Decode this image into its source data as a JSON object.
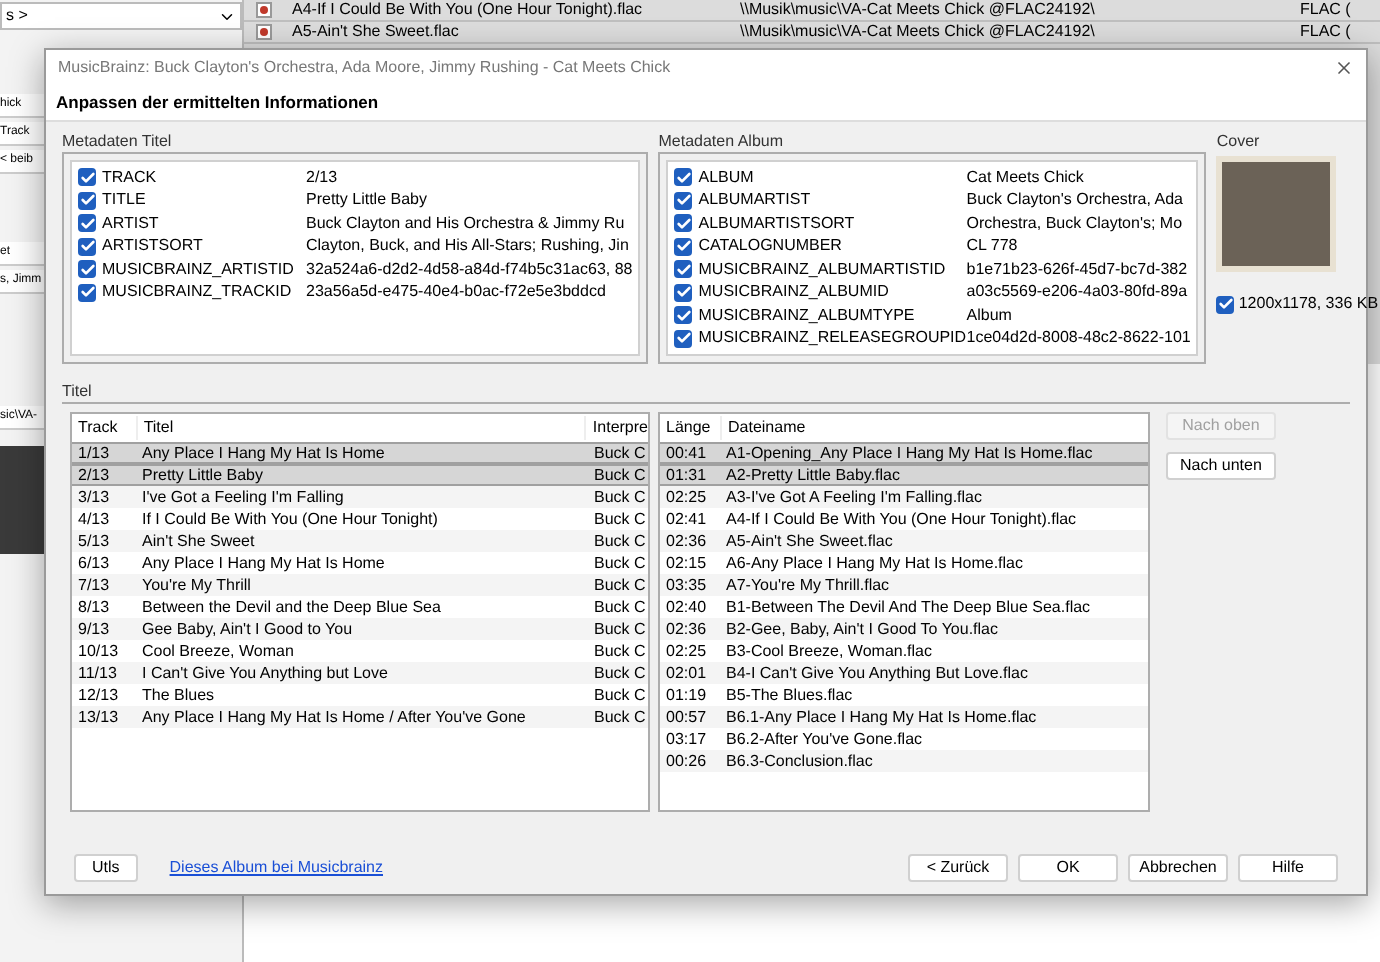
{
  "background": {
    "left_panel": {
      "dropdown_value": "s >",
      "fragments": [
        "hick",
        "Track",
        "< beib",
        "et",
        "s, Jimm",
        "sic\\VA-"
      ]
    },
    "file_rows": [
      {
        "name": "A4-If I Could Be With You (One Hour Tonight).flac",
        "path": "\\\\Musik\\music\\VA-Cat Meets Chick @FLAC24192\\",
        "format": "FLAC ("
      },
      {
        "name": "A5-Ain't She Sweet.flac",
        "path": "\\\\Musik\\music\\VA-Cat Meets Chick @FLAC24192\\",
        "format": "FLAC ("
      }
    ]
  },
  "dialog": {
    "title": "MusicBrainz: Buck Clayton's Orchestra, Ada Moore, Jimmy Rushing - Cat Meets Chick",
    "heading": "Anpassen der ermittelten Informationen",
    "track_metadata": {
      "label": "Metadaten Titel",
      "rows": [
        {
          "key": "TRACK",
          "value": "2/13",
          "checked": true
        },
        {
          "key": "TITLE",
          "value": "Pretty Little Baby",
          "checked": true
        },
        {
          "key": "ARTIST",
          "value": "Buck Clayton and His Orchestra & Jimmy Ru",
          "checked": true
        },
        {
          "key": "ARTISTSORT",
          "value": "Clayton, Buck, and His All-Stars; Rushing, Jin",
          "checked": true
        },
        {
          "key": "MUSICBRAINZ_ARTISTID",
          "value": "32a524a6-d2d2-4d58-a84d-f74b5c31ac63, 88",
          "checked": true
        },
        {
          "key": "MUSICBRAINZ_TRACKID",
          "value": "23a56a5d-e475-40e4-b0ac-f72e5e3bddcd",
          "checked": true
        }
      ]
    },
    "album_metadata": {
      "label": "Metadaten Album",
      "rows": [
        {
          "key": "ALBUM",
          "value": "Cat Meets Chick",
          "checked": true
        },
        {
          "key": "ALBUMARTIST",
          "value": "Buck Clayton's Orchestra, Ada",
          "checked": true
        },
        {
          "key": "ALBUMARTISTSORT",
          "value": "Orchestra, Buck Clayton's; Mo",
          "checked": true
        },
        {
          "key": "CATALOGNUMBER",
          "value": "CL 778",
          "checked": true
        },
        {
          "key": "MUSICBRAINZ_ALBUMARTISTID",
          "value": "b1e71b23-626f-45d7-bc7d-382",
          "checked": true
        },
        {
          "key": "MUSICBRAINZ_ALBUMID",
          "value": "a03c5569-e206-4a03-80fd-89a",
          "checked": true
        },
        {
          "key": "MUSICBRAINZ_ALBUMTYPE",
          "value": "Album",
          "checked": true
        },
        {
          "key": "MUSICBRAINZ_RELEASEGROUPID",
          "value": "1ce04d2d-8008-48c2-8622-101",
          "checked": true
        }
      ]
    },
    "cover": {
      "label": "Cover",
      "info": "1200x1178, 336 KB",
      "checked": true
    },
    "titles": {
      "label": "Titel",
      "track_columns": [
        "Track",
        "Titel",
        "Interpre"
      ],
      "tracks": [
        {
          "track": "1/13",
          "title": "Any Place I Hang My Hat Is Home",
          "artist": "Buck C",
          "selected": true
        },
        {
          "track": "2/13",
          "title": "Pretty Little Baby",
          "artist": "Buck C",
          "selected": true
        },
        {
          "track": "3/13",
          "title": "I've Got a Feeling I'm Falling",
          "artist": "Buck C",
          "selected": false
        },
        {
          "track": "4/13",
          "title": "If I Could Be With You (One Hour Tonight)",
          "artist": "Buck C",
          "selected": false
        },
        {
          "track": "5/13",
          "title": "Ain't She Sweet",
          "artist": "Buck C",
          "selected": false
        },
        {
          "track": "6/13",
          "title": "Any Place I Hang My Hat Is Home",
          "artist": "Buck C",
          "selected": false
        },
        {
          "track": "7/13",
          "title": "You're My Thrill",
          "artist": "Buck C",
          "selected": false
        },
        {
          "track": "8/13",
          "title": "Between the Devil and the Deep Blue Sea",
          "artist": "Buck C",
          "selected": false
        },
        {
          "track": "9/13",
          "title": "Gee Baby, Ain't I Good to You",
          "artist": "Buck C",
          "selected": false
        },
        {
          "track": "10/13",
          "title": "Cool Breeze, Woman",
          "artist": "Buck C",
          "selected": false
        },
        {
          "track": "11/13",
          "title": "I Can't Give You Anything but Love",
          "artist": "Buck C",
          "selected": false
        },
        {
          "track": "12/13",
          "title": "The Blues",
          "artist": "Buck C",
          "selected": false
        },
        {
          "track": "13/13",
          "title": "Any Place I Hang My Hat Is Home / After You've Gone",
          "artist": "Buck C",
          "selected": false
        }
      ],
      "file_columns": [
        "Länge",
        "Dateiname"
      ],
      "files": [
        {
          "length": "00:41",
          "name": "A1-Opening_Any Place I Hang My Hat Is Home.flac",
          "selected": true
        },
        {
          "length": "01:31",
          "name": "A2-Pretty Little Baby.flac",
          "selected": true
        },
        {
          "length": "02:25",
          "name": "A3-I've Got A Feeling I'm Falling.flac",
          "selected": false
        },
        {
          "length": "02:41",
          "name": "A4-If I Could Be With You (One Hour Tonight).flac",
          "selected": false
        },
        {
          "length": "02:36",
          "name": "A5-Ain't She Sweet.flac",
          "selected": false
        },
        {
          "length": "02:15",
          "name": "A6-Any Place I Hang My Hat Is Home.flac",
          "selected": false
        },
        {
          "length": "03:35",
          "name": "A7-You're My Thrill.flac",
          "selected": false
        },
        {
          "length": "02:40",
          "name": "B1-Between The Devil And The Deep Blue Sea.flac",
          "selected": false
        },
        {
          "length": "02:36",
          "name": "B2-Gee, Baby, Ain't I Good To You.flac",
          "selected": false
        },
        {
          "length": "02:25",
          "name": "B3-Cool Breeze, Woman.flac",
          "selected": false
        },
        {
          "length": "02:01",
          "name": "B4-I Can't Give You Anything But Love.flac",
          "selected": false
        },
        {
          "length": "01:19",
          "name": "B5-The Blues.flac",
          "selected": false
        },
        {
          "length": "00:57",
          "name": "B6.1-Any Place I Hang My Hat Is Home.flac",
          "selected": false
        },
        {
          "length": "03:17",
          "name": "B6.2-After You've Gone.flac",
          "selected": false
        },
        {
          "length": "00:26",
          "name": "B6.3-Conclusion.flac",
          "selected": false
        }
      ],
      "move_buttons": [
        {
          "label": "Nach oben",
          "disabled": true
        },
        {
          "label": "Nach unten",
          "disabled": false
        }
      ]
    },
    "footer": {
      "utils": "Utls",
      "link": "Dieses Album bei Musicbrainz",
      "buttons": [
        "< Zurück",
        "OK",
        "Abbrechen",
        "Hilfe"
      ]
    }
  }
}
